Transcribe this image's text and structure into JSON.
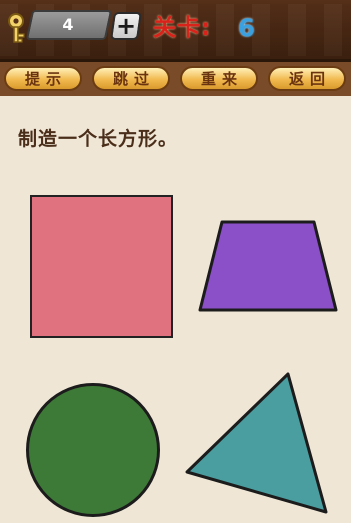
{
  "header": {
    "hint_count": "4",
    "add_hint_symbol": "+",
    "level_label": "关卡:",
    "level_number": "6"
  },
  "menu": {
    "hint_label": "提示",
    "skip_label": "跳过",
    "restart_label": "重来",
    "back_label": "返回"
  },
  "task": {
    "prompt": "制造一个长方形。"
  },
  "shapes": {
    "square_color": "#e0717e",
    "trapezoid_color": "#8b4fc8",
    "circle_color": "#3e7a37",
    "triangle_color": "#4b9ea0"
  }
}
